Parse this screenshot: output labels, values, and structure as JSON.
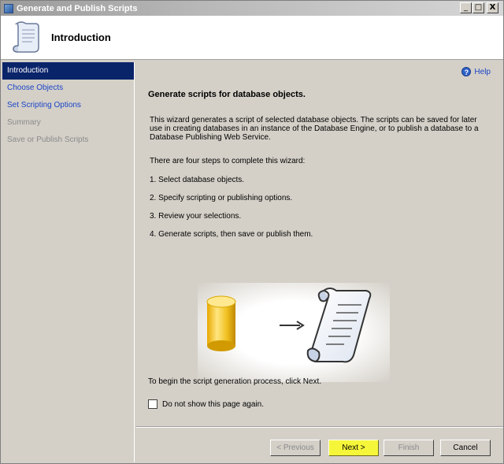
{
  "window": {
    "title": "Generate and Publish Scripts",
    "minimize": "_",
    "maximize": "□",
    "close": "X"
  },
  "header": {
    "heading": "Introduction"
  },
  "nav": {
    "items": [
      {
        "label": "Introduction",
        "state": "active"
      },
      {
        "label": "Choose Objects",
        "state": "link"
      },
      {
        "label": "Set Scripting Options",
        "state": "link"
      },
      {
        "label": "Summary",
        "state": "disabled"
      },
      {
        "label": "Save or Publish Scripts",
        "state": "disabled"
      }
    ]
  },
  "main": {
    "help_label": "Help",
    "title": "Generate scripts for database objects.",
    "description": "This wizard generates a script of selected database objects. The scripts can be saved for later use in creating databases in an instance of the Database Engine, or to publish a database to a Database Publishing Web Service.",
    "steps_intro": "There are four steps to complete this wizard:",
    "steps": [
      "1. Select database objects.",
      " 2. Specify scripting or publishing options.",
      "3. Review your selections.",
      "4. Generate scripts, then save or publish them."
    ],
    "begin_text": "To begin the script generation process, click Next.",
    "checkbox_label": "Do not show this page again.",
    "checkbox_checked": false
  },
  "footer": {
    "previous": "< Previous",
    "next": "Next >",
    "finish": "Finish",
    "cancel": "Cancel"
  },
  "colors": {
    "nav_active": "#0a246a",
    "link": "#1a44c6",
    "next_highlight": "#f5f53a"
  }
}
